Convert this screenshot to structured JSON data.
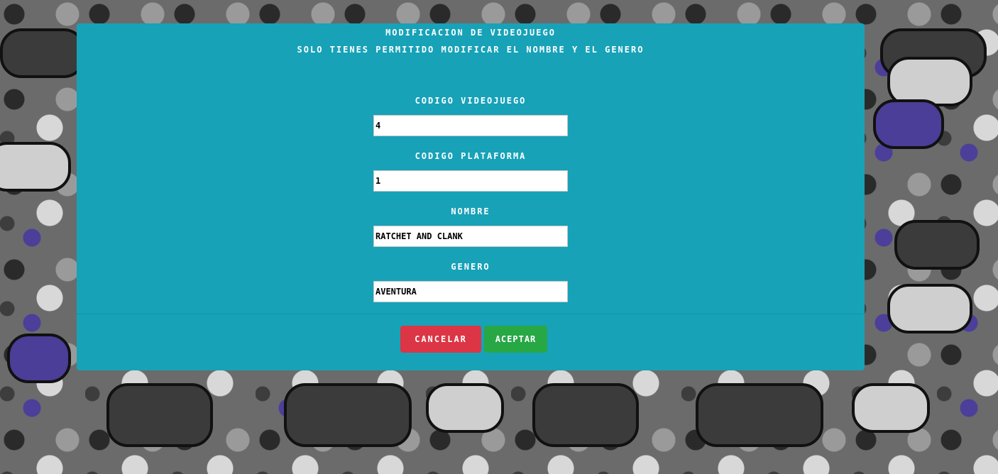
{
  "modal": {
    "title": "MODIFICACION DE VIDEOJUEGO",
    "subtitle": "SOLO TIENES PERMITIDO MODIFICAR EL NOMBRE Y EL GENERO"
  },
  "form": {
    "codigo_videojuego": {
      "label": "CODIGO VIDEOJUEGO",
      "value": "4"
    },
    "codigo_plataforma": {
      "label": "CODIGO PLATAFORMA",
      "value": "1"
    },
    "nombre": {
      "label": "NOMBRE",
      "value": "RATCHET AND CLANK"
    },
    "genero": {
      "label": "GENERO",
      "value": "AVENTURA"
    }
  },
  "buttons": {
    "cancel_label": "CANCELAR",
    "accept_label": "ACEPTAR"
  },
  "colors": {
    "modal_bg": "#17a2b8",
    "cancel": "#dc3545",
    "accept": "#28a745"
  },
  "background": {
    "description_icon": "game-controllers-pattern"
  }
}
